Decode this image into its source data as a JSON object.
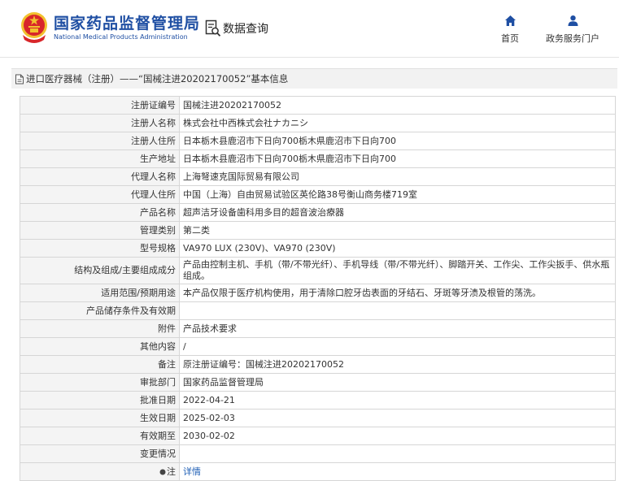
{
  "header": {
    "logo_cn": "国家药品监督管理局",
    "logo_en": "National Medical Products Administration",
    "query_label": "数据查询",
    "nav": [
      {
        "label": "首页",
        "icon": "home-icon"
      },
      {
        "label": "政务服务门户",
        "icon": "user-icon"
      }
    ]
  },
  "breadcrumb": {
    "icon": "document-icon",
    "text": "进口医疗器械（注册）——“国械注进20202170052”基本信息"
  },
  "record": {
    "rows": [
      {
        "label": "注册证编号",
        "value": "国械注进20202170052"
      },
      {
        "label": "注册人名称",
        "value": "株式会社中西株式会社ナカニシ"
      },
      {
        "label": "注册人住所",
        "value": "日本栃木县鹿沼市下日向700栃木県鹿沼市下日向700"
      },
      {
        "label": "生产地址",
        "value": "日本栃木县鹿沼市下日向700栃木県鹿沼市下日向700"
      },
      {
        "label": "代理人名称",
        "value": "上海弩速克国际贸易有限公司"
      },
      {
        "label": "代理人住所",
        "value": "中国（上海）自由贸易试验区英伦路38号衡山商务楼719室"
      },
      {
        "label": "产品名称",
        "value": "超声洁牙设备歯科用多目的超音波治療器"
      },
      {
        "label": "管理类别",
        "value": "第二类"
      },
      {
        "label": "型号规格",
        "value": "VA970 LUX (230V)、VA970 (230V)"
      },
      {
        "label": "结构及组成/主要组成成分",
        "value": "产品由控制主机、手机（带/不带光纤）、手机导线（带/不带光纤）、脚踏开关、工作尖、工作尖扳手、供水瓶组成。"
      },
      {
        "label": "适用范围/预期用途",
        "value": "本产品仅限于医疗机构使用，用于清除口腔牙齿表面的牙结石、牙斑等牙渍及根管的荡洗。"
      },
      {
        "label": "产品储存条件及有效期",
        "value": ""
      },
      {
        "label": "附件",
        "value": "产品技术要求"
      },
      {
        "label": "其他内容",
        "value": "/"
      },
      {
        "label": "备注",
        "value": "原注册证编号：国械注进20202170052"
      },
      {
        "label": "审批部门",
        "value": "国家药品监督管理局"
      },
      {
        "label": "批准日期",
        "value": "2022-04-21"
      },
      {
        "label": "生效日期",
        "value": "2025-02-03"
      },
      {
        "label": "有效期至",
        "value": "2030-02-02"
      },
      {
        "label": "变更情况",
        "value": ""
      }
    ],
    "note_label": "注",
    "note_link": "详情"
  },
  "colors": {
    "brand_blue": "#1f4fa3",
    "link_blue": "#1f5fb5",
    "emblem_red": "#d8262a",
    "emblem_gold": "#f2c12e"
  }
}
